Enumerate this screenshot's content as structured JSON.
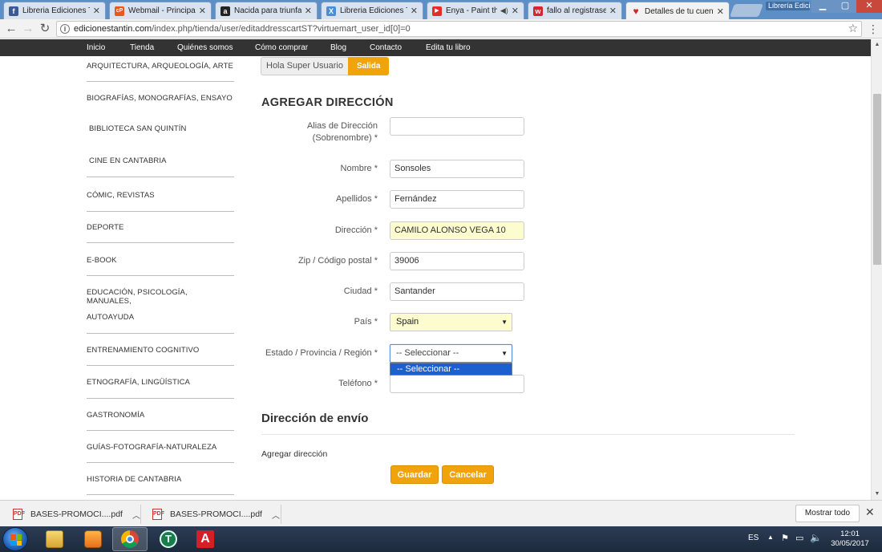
{
  "browser": {
    "tabs": [
      {
        "title": "Libreria Ediciones Tá",
        "favicon_color": "#3b5998",
        "favicon_glyph": "f"
      },
      {
        "title": "Webmail - Principal",
        "favicon_color": "#e8571c",
        "favicon_glyph": "cP"
      },
      {
        "title": "Nacida para triunfar",
        "favicon_color": "#222222",
        "favicon_glyph": "a"
      },
      {
        "title": "Libreria Ediciones Tá",
        "favicon_color": "#4a8fd6",
        "favicon_glyph": "X"
      },
      {
        "title": "Enya - Paint the",
        "favicon_color": "#e52d27",
        "favicon_glyph": "▶"
      },
      {
        "title": "fallo al registrase cli",
        "favicon_color": "#d9232d",
        "favicon_glyph": "w"
      },
      {
        "title": "Detalles de tu cuenta",
        "favicon_color": "#cc2a2a",
        "favicon_glyph": "♥"
      }
    ],
    "window_label": "Librería Edicio...",
    "url_host": "edicionestantin.com",
    "url_path": "/index.php/tienda/user/editaddresscartST?virtuemart_user_id[0]=0"
  },
  "sitenav": [
    "Inicio",
    "Tienda",
    "Quiénes somos",
    "Cómo comprar",
    "Blog",
    "Contacto",
    "Edita tu libro"
  ],
  "categories": [
    "ARQUITECTURA, ARQUEOLOGÍA, ARTE",
    "BIOGRAFÍAS, MONOGRAFÍAS, ENSAYO",
    "BIBLIOTECA SAN QUINTÍN",
    "CINE EN CANTABRIA",
    "CÓMIC, REVISTAS",
    "DEPORTE",
    "E-BOOK",
    "EDUCACIÓN, PSICOLOGÍA, MANUALES,",
    "AUTOAYUDA",
    "ENTRENAMIENTO COGNITIVO",
    "ETNOGRAFÍA, LINGÜÍSTICA",
    "GASTRONOMÍA",
    "GUÍAS-FOTOGRAFÍA-NATURALEZA",
    "HISTORIA DE CANTABRIA"
  ],
  "user": {
    "greeting": "Hola Super Usuario",
    "logout": "Salida"
  },
  "form": {
    "title": "AGREGAR DIRECCIÓN",
    "alias_label_1": "Alias de Dirección",
    "alias_label_2": "(Sobrenombre) *",
    "alias_value": "",
    "nombre_label": "Nombre *",
    "nombre_value": "Sonsoles",
    "apellidos_label": "Apellidos *",
    "apellidos_value": "Fernández",
    "direccion_label": "Dirección *",
    "direccion_value": "CAMILO ALONSO VEGA 10",
    "zip_label": "Zip / Código postal *",
    "zip_value": "39006",
    "ciudad_label": "Ciudad *",
    "ciudad_value": "Santander",
    "pais_label": "País *",
    "pais_value": "Spain",
    "estado_label": "Estado / Provincia / Región *",
    "estado_value": "-- Seleccionar --",
    "estado_options": [
      "-- Seleccionar --"
    ],
    "telefono_label": "Teléfono *",
    "telefono_value": ""
  },
  "shipping": {
    "title": "Dirección de envío",
    "add_link": "Agregar dirección"
  },
  "buttons": {
    "save": "Guardar",
    "cancel": "Cancelar"
  },
  "downloads": {
    "items": [
      "BASES-PROMOCI....pdf",
      "BASES-PROMOCI....pdf"
    ],
    "show_all": "Mostrar todo"
  },
  "taskbar": {
    "language": "ES",
    "time": "12:01",
    "date": "30/05/2017"
  },
  "colors": {
    "accent": "#f0a30a",
    "nav_bg": "#333333",
    "highlight_field": "#fcfccf",
    "dropdown_selected": "#1e5fcf"
  }
}
